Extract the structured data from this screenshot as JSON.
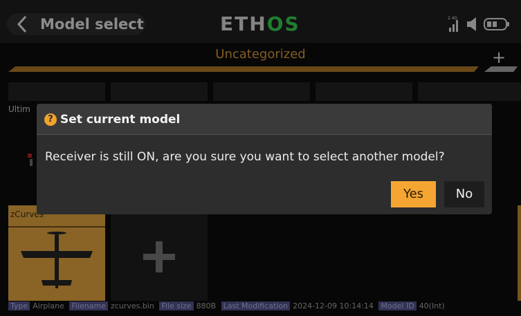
{
  "header": {
    "title": "Model select",
    "logo_prefix": "ETH",
    "logo_suffix": "OS",
    "signal_label": "2.4G"
  },
  "category": {
    "label": "Uncategorized",
    "add_label": "+"
  },
  "models": [
    {
      "name": "Ultim"
    },
    {
      "name": "zCurves"
    }
  ],
  "add_model": {
    "label": "+"
  },
  "footer": {
    "type_tag": "Type",
    "type_value": "Airplane",
    "filename_tag": "Filename",
    "filename_value": "zcurves.bin",
    "filesize_tag": "File size",
    "filesize_value": "880B",
    "modified_tag": "Last Modification",
    "modified_value": "2024-12-09 10:14:14",
    "modelid_tag": "Model ID",
    "modelid_value": "40(Int)"
  },
  "dialog": {
    "icon": "question-icon",
    "icon_glyph": "?",
    "title": "Set current model",
    "message": "Receiver is still ON, are you sure you want to select another model?",
    "yes_label": "Yes",
    "no_label": "No"
  },
  "colors": {
    "accent": "#f5a632",
    "category": "#c89138",
    "logo_green": "#32c24a"
  }
}
